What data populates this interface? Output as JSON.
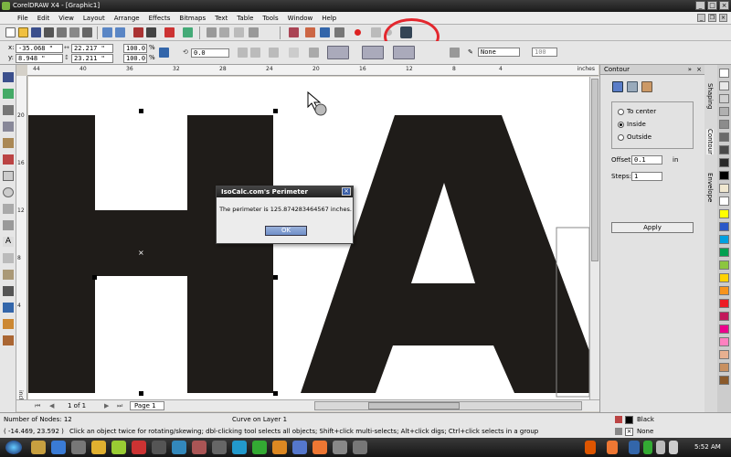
{
  "window": {
    "title": "CorelDRAW X4 - [Graphic1]",
    "min": "_",
    "max": "□",
    "close": "×"
  },
  "menu": [
    "File",
    "Edit",
    "View",
    "Layout",
    "Arrange",
    "Effects",
    "Bitmaps",
    "Text",
    "Table",
    "Tools",
    "Window",
    "Help"
  ],
  "propbar": {
    "x_label": "x:",
    "x_value": "-35.068 \"",
    "y_label": "y:",
    "y_value": "8.948 \"",
    "w_value": "22.217 \"",
    "h_value": "23.211 \"",
    "scale_x": "100.0",
    "scale_y": "100.0",
    "pct": "%",
    "rotation": "0.0",
    "outline": "None",
    "outline_width": "100"
  },
  "ruler": {
    "unit": "inches",
    "h_ticks": [
      "44",
      "40",
      "36",
      "32",
      "28",
      "24",
      "20",
      "16",
      "12",
      "8",
      "4"
    ],
    "v_ticks": [
      "20",
      "16",
      "12",
      "8",
      "4"
    ]
  },
  "dialog": {
    "title": "IsoCalc.com's Perimeter",
    "message": "The perimeter is 125.874283464567 inches.",
    "ok": "OK",
    "close": "×"
  },
  "docker": {
    "title": "Contour",
    "options": [
      "To center",
      "Inside",
      "Outside"
    ],
    "selected": "Inside",
    "offset_label": "Offset:",
    "offset_value": "0.1",
    "offset_unit": "in",
    "steps_label": "Steps:",
    "steps_value": "1",
    "apply": "Apply",
    "side_tabs": [
      "Shaping",
      "Contour",
      "Envelope"
    ]
  },
  "page_nav": {
    "of": "1 of 1",
    "tab": "Page 1"
  },
  "status": {
    "nodes": "Number of Nodes: 12",
    "layer": "Curve on Layer 1",
    "coords": "( -14.469, 23.592 )",
    "hint": "Click an object twice for rotating/skewing; dbl-clicking tool selects all objects; Shift+click multi-selects; Alt+click digs; Ctrl+click selects in a group",
    "fill": "Black",
    "outline": "None"
  },
  "taskbar": {
    "time": "5:52 AM"
  },
  "colors": {
    "shape": "#1f1c19",
    "highlight": "#e3272e",
    "accent": "#3a5fa8"
  },
  "palette": [
    "#ffffff",
    "#e8e8e8",
    "#d0d0d0",
    "#b0b0b0",
    "#8c8c8c",
    "#6a6a6a",
    "#4a4a4a",
    "#2a2a2a",
    "#000000",
    "#f0e8d0",
    "#ffffff",
    "#ffff00",
    "#2b57c8",
    "#00a0e0",
    "#00a050",
    "#8cc63f",
    "#ffd200",
    "#f7941d",
    "#ed1c24",
    "#c2185b",
    "#ec008c",
    "#ff80c0",
    "#e8b090",
    "#c89060",
    "#8b5a2b"
  ]
}
